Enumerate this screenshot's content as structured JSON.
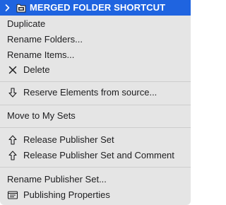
{
  "tree": {
    "selected_item": "MERGED FOLDER SHORTCUT",
    "expander_icon": "chevron-right-icon",
    "item_icon": "folder-shortcut-icon"
  },
  "colors": {
    "selection": "#1f64e0",
    "menu_background": "#e5e5e5",
    "menu_text": "#1d1d1f",
    "separator": "#cdcdcd"
  },
  "menu": {
    "items": [
      {
        "label": "Duplicate"
      },
      {
        "label": "Rename Folders..."
      },
      {
        "label": "Rename Items..."
      },
      {
        "label": "Delete",
        "icon": "close-icon"
      },
      {
        "label": "Reserve Elements from source...",
        "icon": "arrow-down-outline-icon"
      },
      {
        "label": "Move to My Sets"
      },
      {
        "label": "Release Publisher Set",
        "icon": "arrow-up-outline-icon"
      },
      {
        "label": "Release Publisher Set and Comment",
        "icon": "arrow-up-outline-icon"
      },
      {
        "label": "Rename Publisher Set..."
      },
      {
        "label": "Publishing Properties",
        "icon": "properties-icon"
      }
    ]
  }
}
